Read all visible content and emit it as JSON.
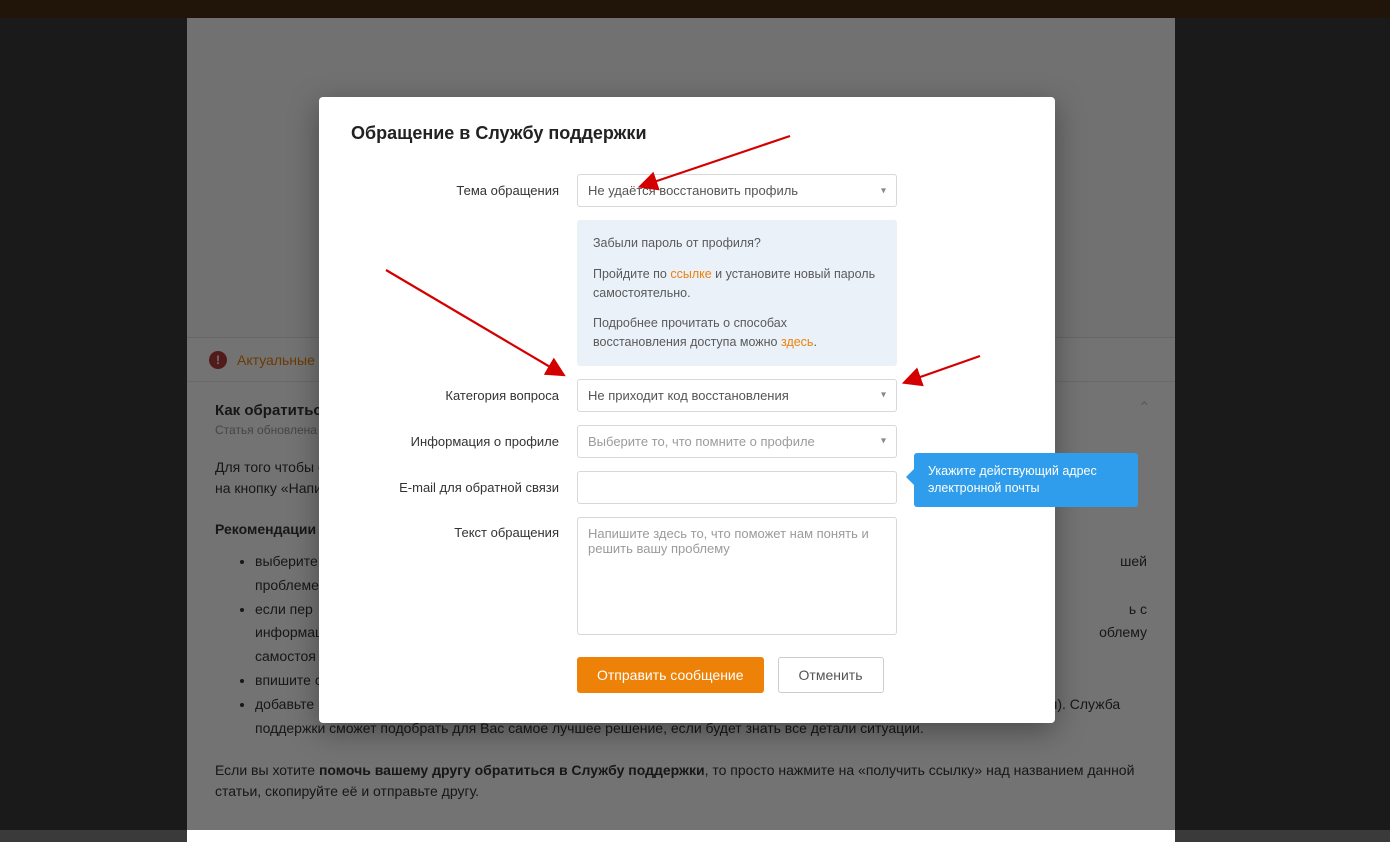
{
  "background": {
    "alert_label": "Актуальные",
    "article_title": "Как обратиться",
    "article_sub": "Статья обновлена",
    "intro_1": "Для того чтобы о",
    "intro_2": "на кнопку «Напи",
    "recs_heading": "Рекомендации",
    "bullets": [
      "выберите",
      "проблеме",
      "если пер",
      "информац",
      "самостоя",
      "впишите с",
      "добавьте подробное описание вашей проблемы или вопроса в специальное поле «Текст обращения» (если такое имеется). Служба поддержки сможет подобрать для Вас самое лучшее решение, если будет знать все детали ситуации."
    ],
    "outro_1a": "Если вы хотите ",
    "outro_1b": "помочь вашему другу обратиться в Службу поддержки",
    "outro_1c": ", то просто нажмите на «получить ссылку» над названием данной статьи, скопируйте её и отправьте другу.",
    "bg_tail_1": "шей",
    "bg_tail_2": "ь с",
    "bg_tail_3": "облему"
  },
  "modal": {
    "title": "Обращение в Службу поддержки",
    "labels": {
      "topic": "Тема обращения",
      "category": "Категория вопроса",
      "profile_info": "Информация о профиле",
      "email": "E-mail для обратной связи",
      "text": "Текст обращения"
    },
    "values": {
      "topic": "Не удаётся восстановить профиль",
      "category": "Не приходит код восстановления",
      "profile_info": "Выберите то, что помните о профиле"
    },
    "placeholders": {
      "textarea": "Напишите здесь то, что поможет нам понять и решить вашу проблему"
    },
    "hint": {
      "forgot": "Забыли пароль от профиля?",
      "p2a": "Пройдите по ",
      "p2_link": "ссылке",
      "p2b": " и установите новый пароль самостоятельно.",
      "p3a": "Подробнее прочитать о способах восстановления доступа можно ",
      "p3_link": "здесь",
      "p3b": "."
    },
    "buttons": {
      "submit": "Отправить сообщение",
      "cancel": "Отменить"
    }
  },
  "tooltip": "Укажите действующий адрес электронной почты"
}
